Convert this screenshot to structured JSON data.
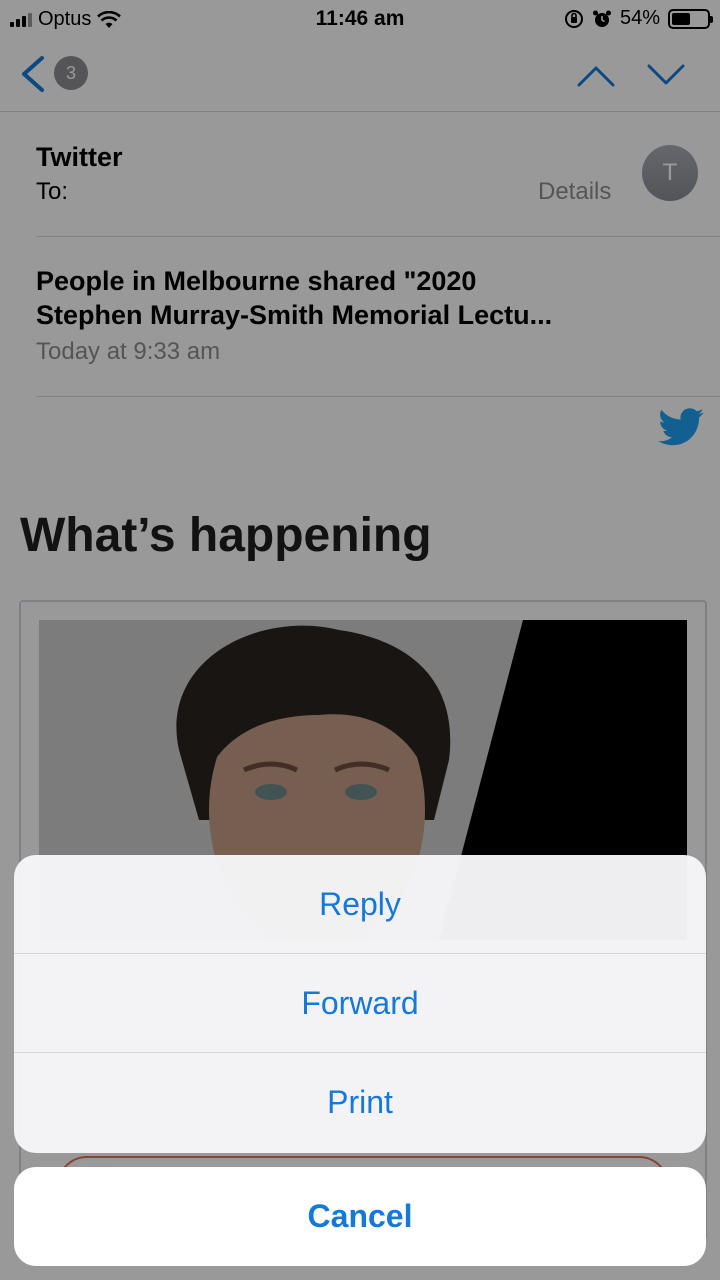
{
  "status_bar": {
    "carrier": "Optus",
    "time": "11:46 am",
    "battery_percent": "54%",
    "battery_level": 0.54,
    "icons": [
      "signal-icon",
      "wifi-icon",
      "orientation-lock-icon",
      "alarm-icon",
      "battery-icon"
    ]
  },
  "nav": {
    "unread_count": "3",
    "icons": [
      "back-chevron-icon",
      "chevron-up-icon",
      "chevron-down-icon"
    ]
  },
  "email": {
    "sender": "Twitter",
    "to_label": "To:",
    "details_label": "Details",
    "avatar_initial": "T",
    "subject_line1": "People in Melbourne shared \"2020",
    "subject_line2": "Stephen Murray-Smith Memorial Lectu...",
    "date": "Today at 9:33 am",
    "body_heading": "What’s happening"
  },
  "action_sheet": {
    "items": [
      "Reply",
      "Forward",
      "Print"
    ],
    "cancel_label": "Cancel"
  },
  "colors": {
    "accent": "#1479d8",
    "twitter_blue": "#1da1f2",
    "overlay": "rgba(0,0,0,0.40)"
  }
}
